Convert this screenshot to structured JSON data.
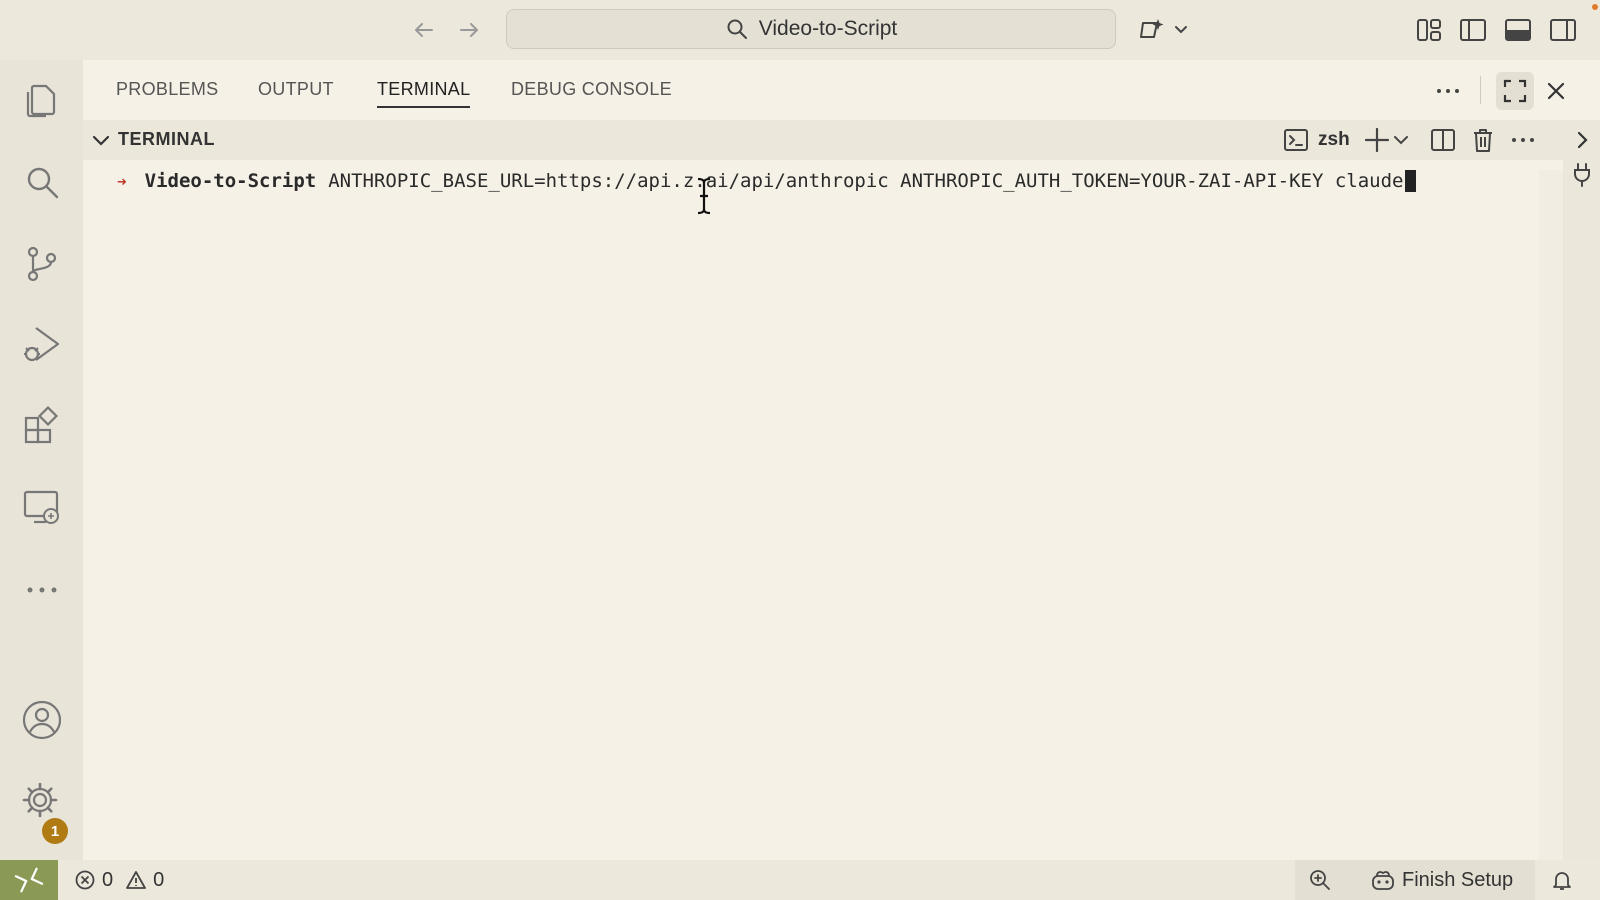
{
  "titlebar": {
    "search_text": "Video-to-Script"
  },
  "panel": {
    "tabs": [
      {
        "label": "PROBLEMS"
      },
      {
        "label": "OUTPUT"
      },
      {
        "label": "TERMINAL"
      },
      {
        "label": "DEBUG CONSOLE"
      }
    ],
    "active_tab": "TERMINAL",
    "section_title": "TERMINAL",
    "shell_name": "zsh"
  },
  "terminal": {
    "prompt_symbol": "➜",
    "directory": "Video-to-Script",
    "command": "ANTHROPIC_BASE_URL=https://api.z.ai/api/anthropic ANTHROPIC_AUTH_TOKEN=YOUR-ZAI-API-KEY claude"
  },
  "activitybar": {
    "settings_badge": "1"
  },
  "statusbar": {
    "errors": "0",
    "warnings": "0",
    "finish_setup": "Finish Setup"
  },
  "colors": {
    "accent_remote": "#8a9a55",
    "badge": "#b07b12",
    "prompt_arrow": "#c0392b"
  }
}
